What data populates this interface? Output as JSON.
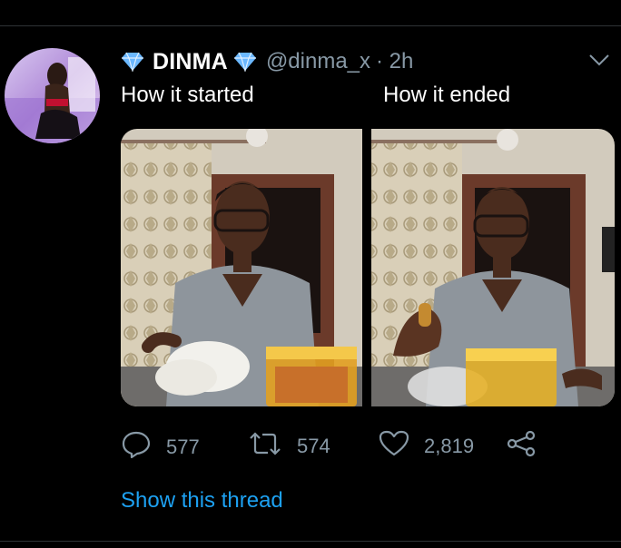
{
  "tweet": {
    "display_name": "DINMA",
    "handle": "@dinma_x",
    "time": "· 2h",
    "text_left": "How it started",
    "text_right": "How it ended",
    "counts": {
      "replies": "577",
      "retweets": "574",
      "likes": "2,819"
    },
    "show_thread": "Show this thread"
  },
  "colors": {
    "background": "#000000",
    "muted": "#8899a6",
    "link": "#1da1f2",
    "verified": "#6bb8ff"
  },
  "icons": [
    "diamond-icon",
    "chevron-down-icon",
    "reply-icon",
    "retweet-icon",
    "heart-icon",
    "share-icon"
  ]
}
